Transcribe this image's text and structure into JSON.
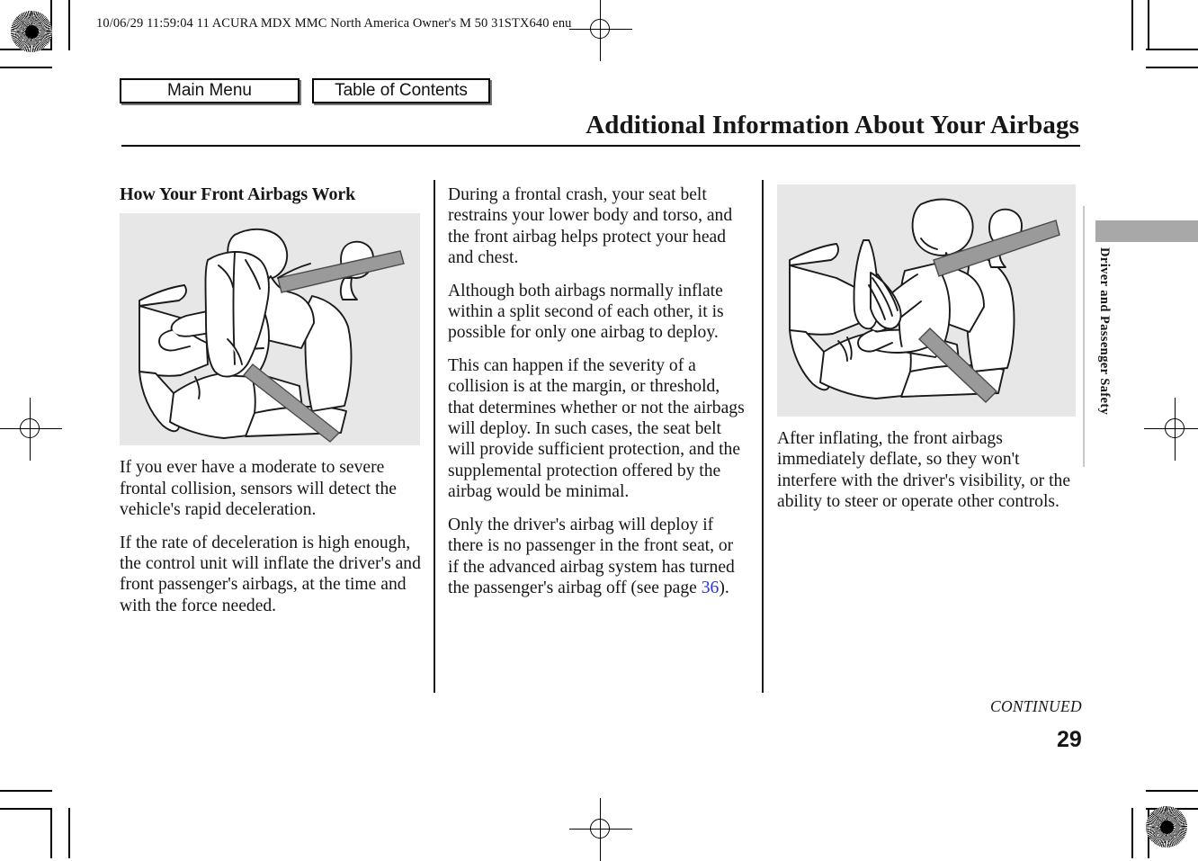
{
  "header": {
    "meta": "10/06/29 11:59:04    11 ACURA MDX MMC North America Owner's M 50 31STX640 enu",
    "title": "Additional Information About Your Airbags"
  },
  "nav": {
    "main_menu_label": "Main Menu",
    "table_of_contents_label": "Table of Contents"
  },
  "column_1": {
    "heading": "How Your Front Airbags Work",
    "illustration_caption": "driver with deployed front airbag",
    "paragraph_1": "If you ever have a moderate to severe frontal collision, sensors will detect the vehicle's rapid deceleration.",
    "paragraph_2": "If the rate of deceleration is high enough, the control unit will inflate the driver's and front passenger's airbags, at the time and with the force needed."
  },
  "column_2": {
    "paragraph_1": "During a frontal crash, your seat belt restrains your lower body and torso, and the front airbag helps protect your head and chest.",
    "paragraph_2": "Although both airbags normally inflate within a split second of each other, it is possible for only one airbag to deploy.",
    "paragraph_3": "This can happen if the severity of a collision is at the margin, or threshold, that determines whether or not the airbags will deploy. In such cases, the seat belt will provide sufficient protection, and the supplemental protection offered by the airbag would be minimal.",
    "paragraph_4_before_link": "Only the driver's airbag will deploy if there is no passenger in the front seat, or if the advanced airbag system has turned the passenger's airbag off (see page ",
    "paragraph_4_link": "36",
    "paragraph_4_after_link": ")."
  },
  "column_3": {
    "illustration_caption": "driver after front airbag has deflated",
    "paragraph_1": "After inflating, the front airbags immediately deflate, so they won't interfere with the driver's visibility, or the ability to steer or operate other controls."
  },
  "side_tab": {
    "label": "Driver and Passenger Safety",
    "band_color": "#a8a8a8"
  },
  "footer": {
    "continued": "CONTINUED",
    "page_number": "29"
  },
  "colors": {
    "link": "#2b35d8",
    "illustration_background": "#e7e7e7",
    "seatbelt_gray": "#9a9a9a",
    "rule": "#000000"
  }
}
